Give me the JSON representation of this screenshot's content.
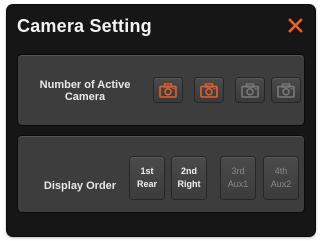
{
  "dialog": {
    "title": "Camera Setting",
    "close_label": "X"
  },
  "active_cameras": {
    "label": "Number of Active Camera",
    "cameras": [
      {
        "icon": "camera-icon",
        "active": true
      },
      {
        "icon": "camera-icon",
        "active": true
      },
      {
        "icon": "camera-icon",
        "active": false
      },
      {
        "icon": "camera-icon",
        "active": false
      }
    ]
  },
  "display_order": {
    "label": "Display Order",
    "slots": [
      {
        "order": "1st",
        "position": "Rear",
        "enabled": true
      },
      {
        "order": "2nd",
        "position": "Right",
        "enabled": true
      },
      {
        "order": "3rd",
        "position": "Aux1",
        "enabled": false
      },
      {
        "order": "4th",
        "position": "Aux2",
        "enabled": false
      }
    ]
  },
  "colors": {
    "accent": "#e8602c",
    "inactive": "#7a7a7a",
    "background": "#161616",
    "panel": "#3d3d3d"
  }
}
